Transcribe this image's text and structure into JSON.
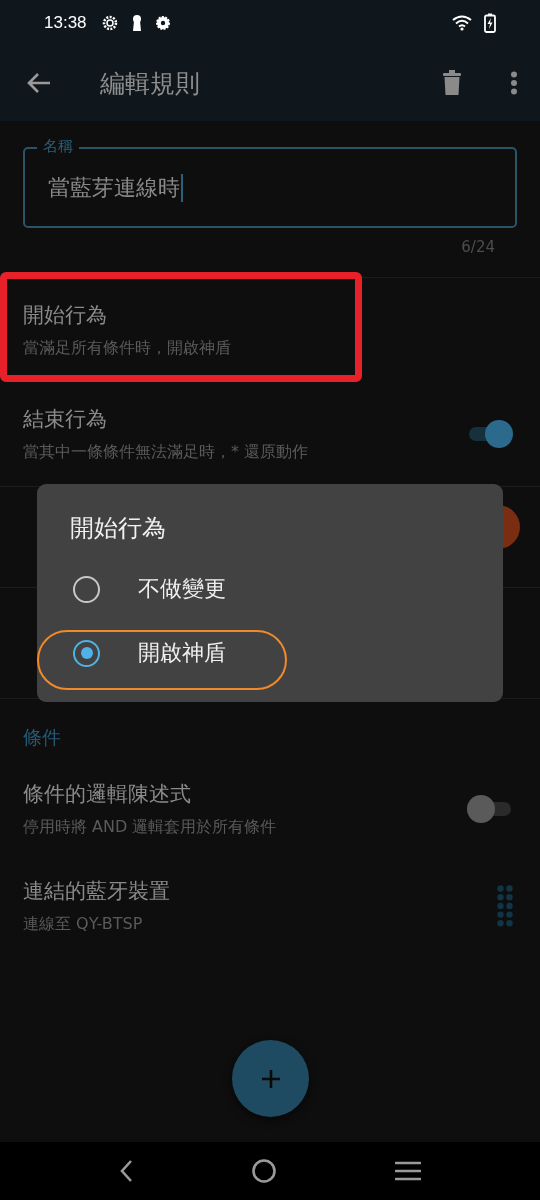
{
  "status_bar": {
    "time": "13:38"
  },
  "app_bar": {
    "title": "編輯規則"
  },
  "name_field": {
    "label": "名稱",
    "value": "當藍芽連線時",
    "counter": "6/24"
  },
  "action_rows": [
    {
      "kind": "plain",
      "title": "開始行為",
      "subtitle": "當滿足所有條件時，開啟神盾",
      "highlighted": true
    },
    {
      "kind": "toggle",
      "title": "結束行為",
      "subtitle": "當其中一條條件無法滿足時，* 還原動作",
      "on": true,
      "highlighted": false
    },
    {
      "kind": "covered-badge"
    },
    {
      "kind": "covered"
    }
  ],
  "conditions": {
    "header": "條件",
    "rows": [
      {
        "kind": "toggle",
        "title": "條件的邏輯陳述式",
        "subtitle": "停用時將 AND 邏輯套用於所有條件",
        "on": false
      },
      {
        "kind": "drag",
        "title": "連結的藍牙裝置",
        "subtitle": "連線至 QY-BTSP"
      }
    ]
  },
  "dialog": {
    "title": "開始行為",
    "options": [
      {
        "label": "不做變更",
        "selected": false,
        "highlighted": false
      },
      {
        "label": "開啟神盾",
        "selected": true,
        "highlighted": true
      }
    ]
  }
}
